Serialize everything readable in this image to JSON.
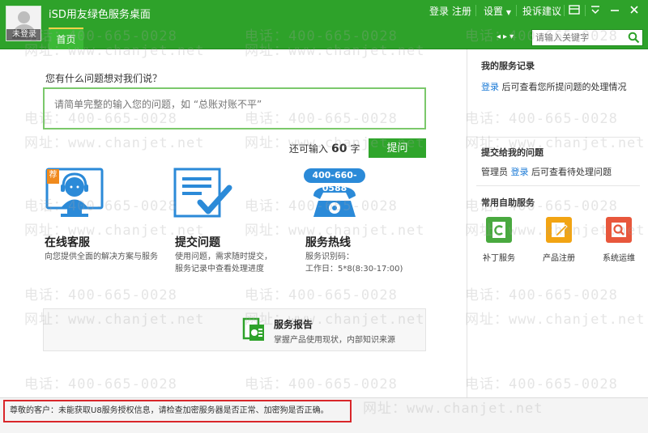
{
  "app": {
    "title": "iSD用友绿色服务桌面",
    "user_badge": "未登录",
    "home_tab": "首页"
  },
  "toolbar": {
    "login": "登录",
    "register": "注册",
    "settings": "设置",
    "feedback": "投诉建议"
  },
  "search": {
    "placeholder": "请输入关键字"
  },
  "question": {
    "title": "您有什么问题想对我们说？",
    "placeholder": "请简单完整的输入您的问题，如 “总账对账不平”",
    "remain_prefix": "还可输入",
    "remain_count": "60",
    "remain_suffix": "字",
    "submit": "提问"
  },
  "services": {
    "online": {
      "badge": "荐",
      "title": "在线客服",
      "desc": "向您提供全面的解决方案与服务"
    },
    "submit": {
      "title": "提交问题",
      "desc1": "使用问题，需求随时提交，",
      "desc2": "服务记录中查看处理进度"
    },
    "hotline": {
      "phone": "400-660-0588",
      "title": "服务热线",
      "desc1": "服务识别码：",
      "desc2": "工作日：5*8(8:30-17:00)"
    },
    "report": {
      "title": "服务报告",
      "desc": "掌握产品使用现状，内部知识来源"
    }
  },
  "side": {
    "records_title": "我的服务记录",
    "records_login": "登录",
    "records_text": "后可查看您所提问题的处理情况",
    "submitted_title": "提交给我的问题",
    "submitted_prefix": "管理员",
    "submitted_login": "登录",
    "submitted_text": "后可查看待处理问题",
    "self_title": "常用自助服务",
    "tiles": [
      "补丁服务",
      "产品注册",
      "系统运维"
    ]
  },
  "status": {
    "message": "尊敬的客户：未能获取U8服务授权信息，请检查加密服务器是否正常、加密狗是否正确。"
  },
  "watermark": {
    "phone": "电话：400-665-0028",
    "site": "网址：www.chanjet.net"
  },
  "colors": {
    "brand_green": "#2ea22a",
    "link_blue": "#1a7ad6",
    "alert_red": "#d9262a",
    "icon_blue": "#2b8ad8"
  }
}
